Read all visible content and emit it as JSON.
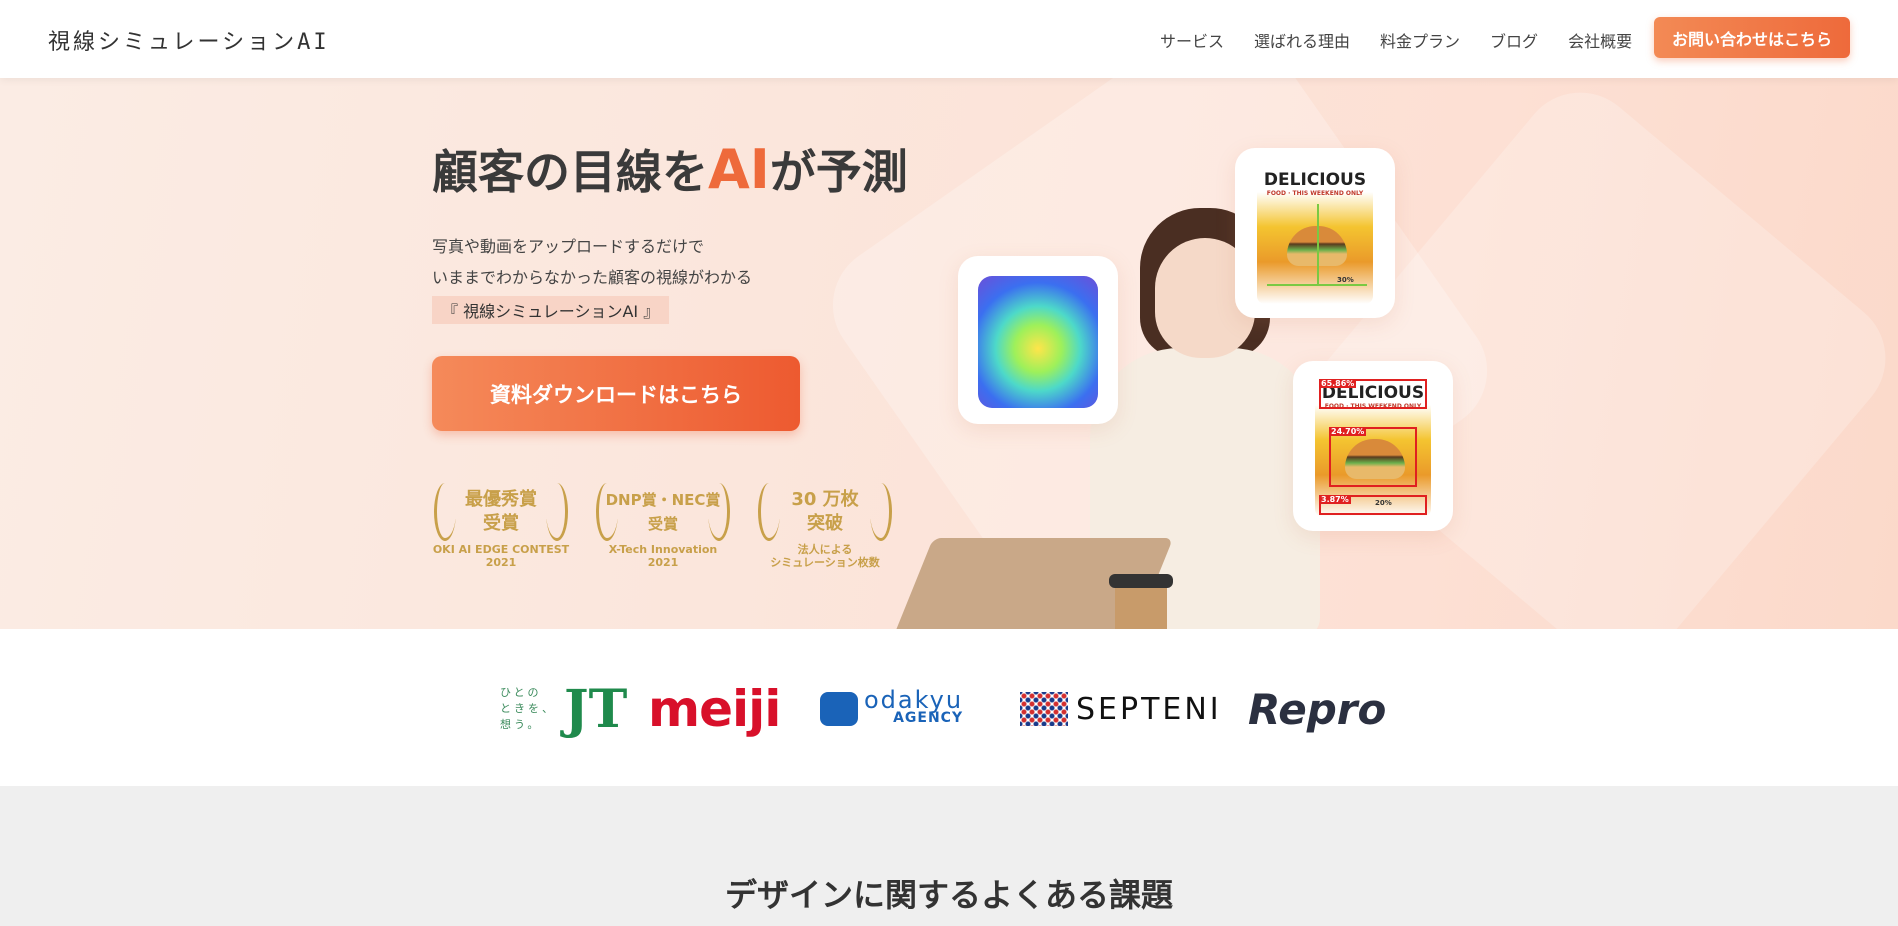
{
  "header": {
    "logo": "視線シミュレーションAI",
    "nav": [
      "サービス",
      "選ばれる理由",
      "料金プラン",
      "ブログ",
      "会社概要"
    ],
    "cta": "お問い合わせはこちら"
  },
  "hero": {
    "title_pre": "顧客の目線を",
    "title_ai": "AI",
    "title_post": "が予測",
    "sub1": "写真や動画をアップロードするだけで",
    "sub2": "いままでわからなかった顧客の視線がわかる",
    "tag": "『 視線シミュレーションAI 』",
    "cta": "資料ダウンロードはこちら",
    "awards": [
      {
        "line1": "最優秀賞",
        "line2": "受賞",
        "cap1": "OKI AI EDGE CONTEST",
        "cap2": "2021"
      },
      {
        "line1": "DNP賞・NEC賞",
        "line2": "受賞",
        "cap1": "X-Tech Innovation",
        "cap2": "2021"
      },
      {
        "line1": "30 万枚",
        "line2": "突破",
        "cap1": "法人による",
        "cap2": "シミュレーション枚数"
      }
    ],
    "poster1": {
      "title": "DELICIOUS",
      "sub": "FOOD · THIS WEEKEND ONLY",
      "pct": "30%"
    },
    "poster2": {
      "title": "DELICIOUS",
      "sub": "FOOD · THIS WEEKEND ONLY",
      "s1": "65.86%",
      "s2": "24.70%",
      "s3": "3.87%",
      "s4": "20%"
    }
  },
  "clients": {
    "jt_small1": "ひとの",
    "jt_small2": "ときを、",
    "jt_small3": "想う。",
    "jt": "JT",
    "meiji": "meiji",
    "odakyu1": "odakyu",
    "odakyu2": "AGENCY",
    "septeni": "SEPTENI",
    "repro": "Repro"
  },
  "issues": {
    "title": "デザインに関するよくある課題"
  },
  "colors": {
    "accent": "#ee6a3b",
    "gold": "#c8a04a",
    "hero_bg": "#fbe6dc"
  }
}
